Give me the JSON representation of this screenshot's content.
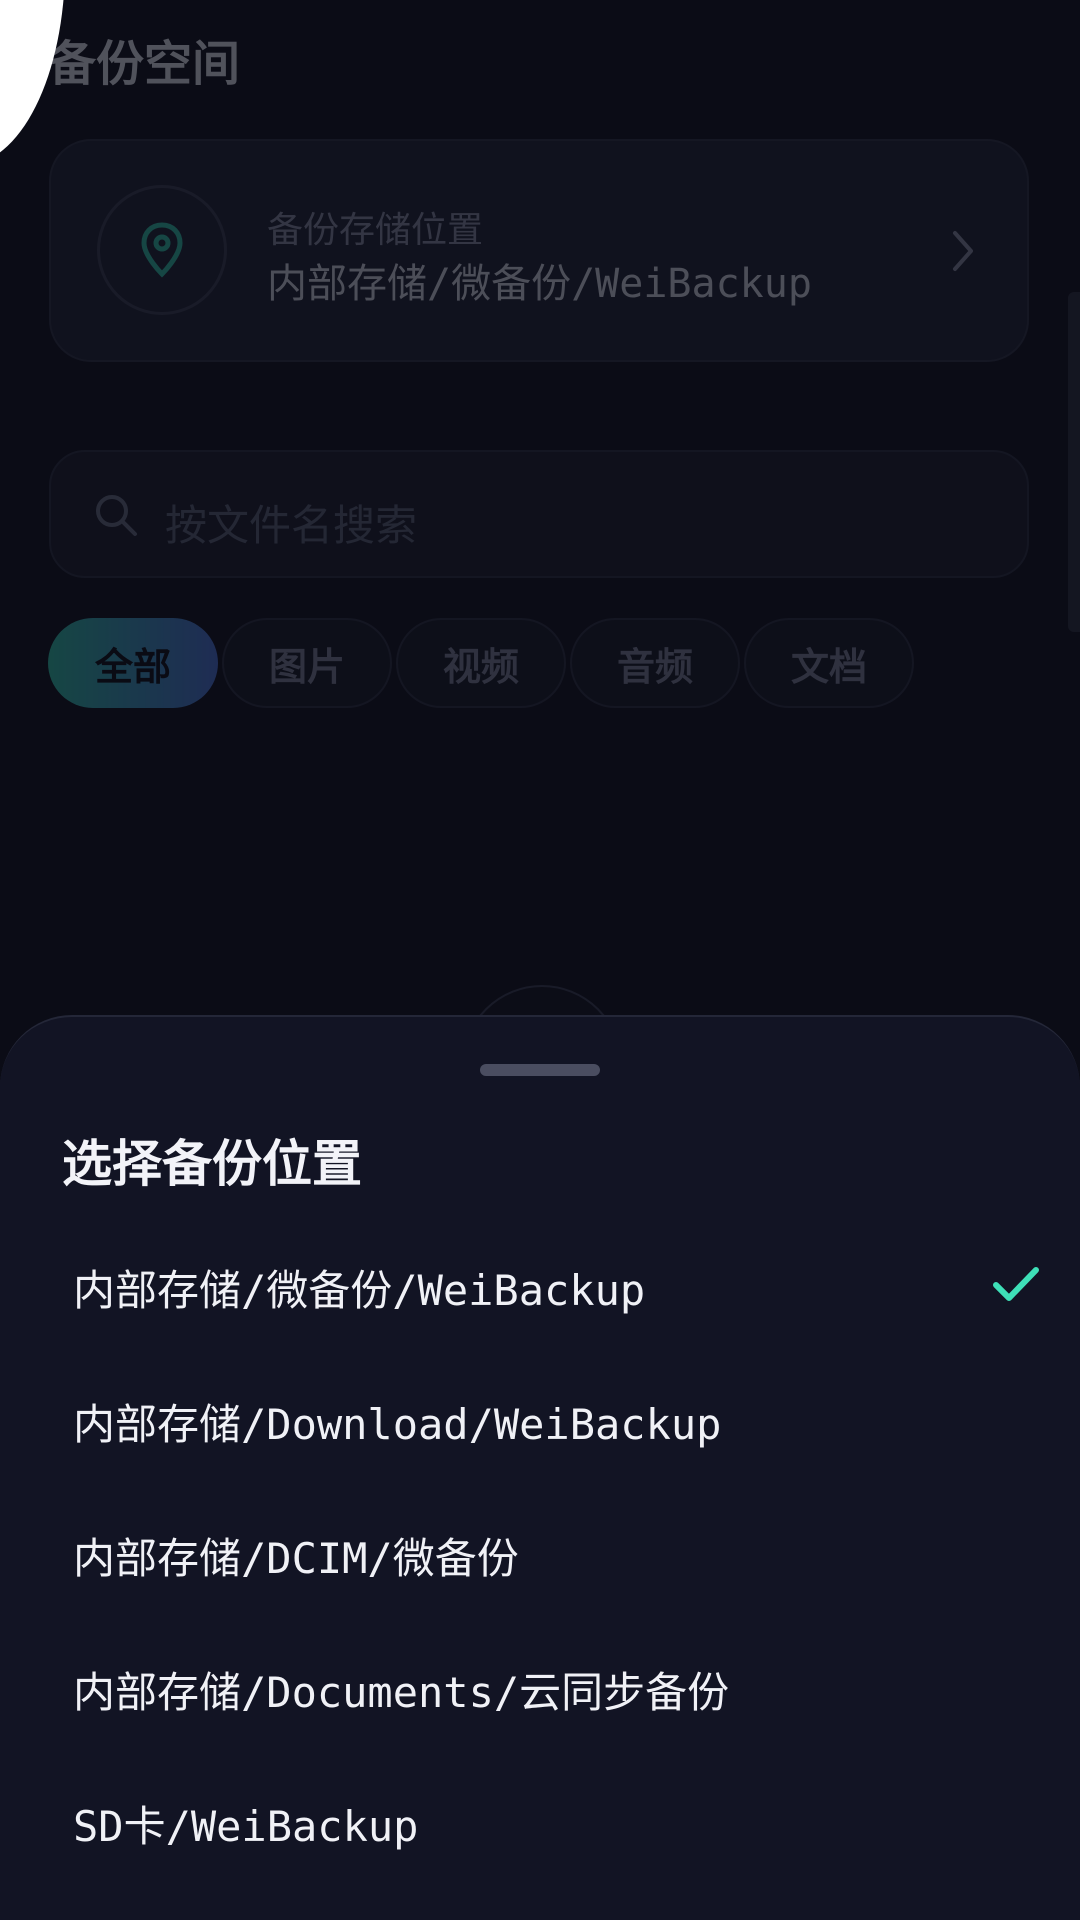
{
  "background": {
    "page_title": "备份空间",
    "location_card": {
      "label": "备份存储位置",
      "path": "内部存储/微备份/WeiBackup"
    },
    "search": {
      "placeholder": "按文件名搜索"
    },
    "filters": [
      {
        "label": "全部",
        "active": true
      },
      {
        "label": "图片",
        "active": false
      },
      {
        "label": "视频",
        "active": false
      },
      {
        "label": "音频",
        "active": false
      },
      {
        "label": "文档",
        "active": false
      }
    ]
  },
  "sheet": {
    "title": "选择备份位置",
    "options": [
      {
        "label": "内部存储/微备份/WeiBackup",
        "selected": true
      },
      {
        "label": "内部存储/Download/WeiBackup",
        "selected": false
      },
      {
        "label": "内部存储/DCIM/微备份",
        "selected": false
      },
      {
        "label": "内部存储/Documents/云同步备份",
        "selected": false
      },
      {
        "label": "SD卡/WeiBackup",
        "selected": false
      }
    ]
  },
  "colors": {
    "accent": "#3ee0b8",
    "background": "#0b0c16",
    "sheet": "#121424"
  },
  "icons": {
    "location": "location-pin-icon",
    "search": "search-icon",
    "chevron": "chevron-right-icon",
    "check": "check-icon"
  }
}
